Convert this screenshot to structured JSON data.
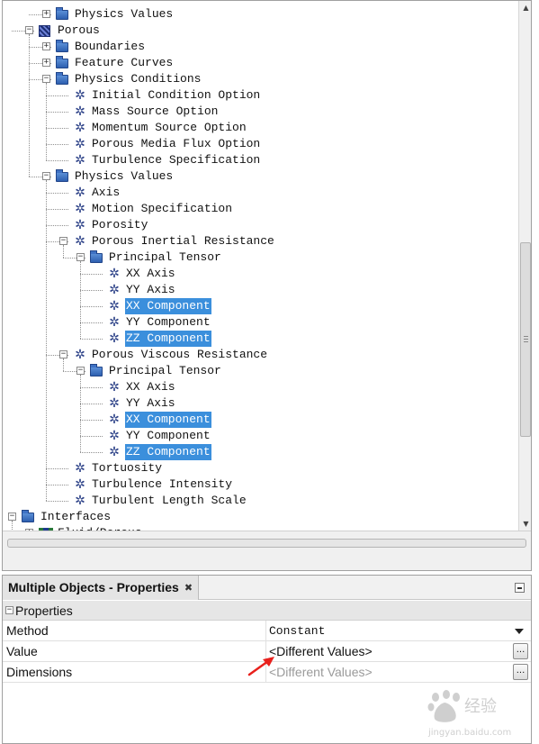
{
  "tree": {
    "nodes": [
      {
        "label": "Physics Values",
        "icon": "folder-icon",
        "depth": 2,
        "toggle": "+",
        "selected": false,
        "line": "mid"
      },
      {
        "label": "Porous",
        "icon": "region-icon",
        "depth": 1,
        "toggle": "-",
        "selected": false,
        "line": "mid"
      },
      {
        "label": "Boundaries",
        "icon": "folder-icon",
        "depth": 2,
        "toggle": "+",
        "selected": false,
        "line": "mid"
      },
      {
        "label": "Feature Curves",
        "icon": "folder-icon",
        "depth": 2,
        "toggle": "+",
        "selected": false,
        "line": "mid"
      },
      {
        "label": "Physics Conditions",
        "icon": "folder-icon",
        "depth": 2,
        "toggle": "-",
        "selected": false,
        "line": "mid"
      },
      {
        "label": "Initial Condition Option",
        "icon": "physics-icon",
        "depth": 3,
        "toggle": "",
        "selected": false,
        "line": "mid"
      },
      {
        "label": "Mass Source Option",
        "icon": "physics-icon",
        "depth": 3,
        "toggle": "",
        "selected": false,
        "line": "mid"
      },
      {
        "label": "Momentum Source Option",
        "icon": "physics-icon",
        "depth": 3,
        "toggle": "",
        "selected": false,
        "line": "mid"
      },
      {
        "label": "Porous Media Flux Option",
        "icon": "physics-icon",
        "depth": 3,
        "toggle": "",
        "selected": false,
        "line": "mid"
      },
      {
        "label": "Turbulence Specification",
        "icon": "physics-icon",
        "depth": 3,
        "toggle": "",
        "selected": false,
        "line": "last"
      },
      {
        "label": "Physics Values",
        "icon": "folder-icon",
        "depth": 2,
        "toggle": "-",
        "selected": false,
        "line": "last"
      },
      {
        "label": "Axis",
        "icon": "physics-icon",
        "depth": 3,
        "toggle": "",
        "selected": false,
        "line": "mid"
      },
      {
        "label": "Motion Specification",
        "icon": "physics-icon",
        "depth": 3,
        "toggle": "",
        "selected": false,
        "line": "mid"
      },
      {
        "label": "Porosity",
        "icon": "physics-icon",
        "depth": 3,
        "toggle": "",
        "selected": false,
        "line": "mid"
      },
      {
        "label": "Porous Inertial Resistance",
        "icon": "physics-icon",
        "depth": 3,
        "toggle": "-",
        "selected": false,
        "line": "mid"
      },
      {
        "label": "Principal Tensor",
        "icon": "folder-icon",
        "depth": 4,
        "toggle": "-",
        "selected": false,
        "line": "last"
      },
      {
        "label": "XX Axis",
        "icon": "physics-icon",
        "depth": 5,
        "toggle": "",
        "selected": false,
        "line": "mid"
      },
      {
        "label": "YY Axis",
        "icon": "physics-icon",
        "depth": 5,
        "toggle": "",
        "selected": false,
        "line": "mid"
      },
      {
        "label": "XX Component",
        "icon": "physics-icon",
        "depth": 5,
        "toggle": "",
        "selected": true,
        "line": "mid"
      },
      {
        "label": "YY Component",
        "icon": "physics-icon",
        "depth": 5,
        "toggle": "",
        "selected": false,
        "line": "mid"
      },
      {
        "label": "ZZ Component",
        "icon": "physics-icon",
        "depth": 5,
        "toggle": "",
        "selected": true,
        "line": "last"
      },
      {
        "label": "Porous Viscous Resistance",
        "icon": "physics-icon",
        "depth": 3,
        "toggle": "-",
        "selected": false,
        "line": "mid"
      },
      {
        "label": "Principal Tensor",
        "icon": "folder-icon",
        "depth": 4,
        "toggle": "-",
        "selected": false,
        "line": "last"
      },
      {
        "label": "XX Axis",
        "icon": "physics-icon",
        "depth": 5,
        "toggle": "",
        "selected": false,
        "line": "mid"
      },
      {
        "label": "YY Axis",
        "icon": "physics-icon",
        "depth": 5,
        "toggle": "",
        "selected": false,
        "line": "mid"
      },
      {
        "label": "XX Component",
        "icon": "physics-icon",
        "depth": 5,
        "toggle": "",
        "selected": true,
        "line": "mid"
      },
      {
        "label": "YY Component",
        "icon": "physics-icon",
        "depth": 5,
        "toggle": "",
        "selected": false,
        "line": "mid"
      },
      {
        "label": "ZZ Component",
        "icon": "physics-icon",
        "depth": 5,
        "toggle": "",
        "selected": true,
        "line": "last"
      },
      {
        "label": "Tortuosity",
        "icon": "physics-icon",
        "depth": 3,
        "toggle": "",
        "selected": false,
        "line": "mid"
      },
      {
        "label": "Turbulence Intensity",
        "icon": "physics-icon",
        "depth": 3,
        "toggle": "",
        "selected": false,
        "line": "mid"
      },
      {
        "label": "Turbulent Length Scale",
        "icon": "physics-icon",
        "depth": 3,
        "toggle": "",
        "selected": false,
        "line": "last"
      },
      {
        "label": "Interfaces",
        "icon": "folder-icon",
        "depth": 0,
        "toggle": "-",
        "selected": false,
        "line": "mid"
      },
      {
        "label": "Fluid/Porous",
        "icon": "interface-icon",
        "depth": 1,
        "toggle": "+",
        "selected": false,
        "line": "mid"
      }
    ]
  },
  "properties_panel": {
    "title": "Multiple Objects - Properties",
    "close_glyph": "✖",
    "section": {
      "toggle": "-",
      "label": "Properties"
    },
    "rows": [
      {
        "name": "Method",
        "value": "Constant",
        "control": "dropdown",
        "value_style": "mono"
      },
      {
        "name": "Value",
        "value": "<Different Values>",
        "control": "ellipsis",
        "value_style": "normal"
      },
      {
        "name": "Dimensions",
        "value": "<Different Values>",
        "control": "ellipsis",
        "value_style": "disabled"
      }
    ],
    "ellipsis_label": "..."
  },
  "colors": {
    "selection": "#3b8fdc",
    "annotation_arrow": "#e8201c",
    "folder": "#3f72c4"
  },
  "watermark": {
    "text": "Baidu 经验",
    "subtext": "jingyan.baidu.com"
  }
}
